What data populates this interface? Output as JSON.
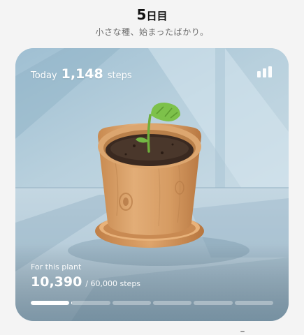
{
  "header": {
    "day_number": "5",
    "day_unit": "日目",
    "subtitle": "小さな種、始まったばかり。"
  },
  "card": {
    "today_label": "Today",
    "today_steps": "1,148",
    "today_unit": "steps",
    "stats_icon": "bar-chart-icon",
    "plant_label": "For this plant",
    "plant_steps": "10,390",
    "plant_goal": "/ 60,000 steps",
    "progress_fraction": 0.17,
    "segment_count": 6
  },
  "colors": {
    "accent": "#ffffff",
    "card_bg": "#b9d0dd",
    "pot": "#d39a5f",
    "soil": "#3b2a20",
    "leaf": "#6db33f"
  }
}
